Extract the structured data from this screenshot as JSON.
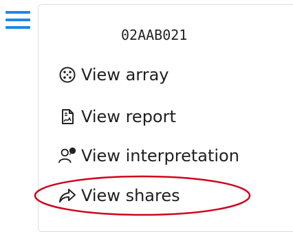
{
  "nav": {
    "menu_icon": "hamburger-menu-icon"
  },
  "panel": {
    "sample_id": "02AAB021",
    "items": [
      {
        "label": "View array",
        "icon": "array-dots-icon"
      },
      {
        "label": "View report",
        "icon": "report-document-icon"
      },
      {
        "label": "View interpretation",
        "icon": "interpretation-users-icon"
      },
      {
        "label": "View shares",
        "icon": "share-arrow-icon"
      }
    ]
  },
  "annotation": {
    "highlight_color": "#d0021b"
  },
  "colors": {
    "accent": "#1e88e5",
    "text": "#1f1f1f"
  }
}
